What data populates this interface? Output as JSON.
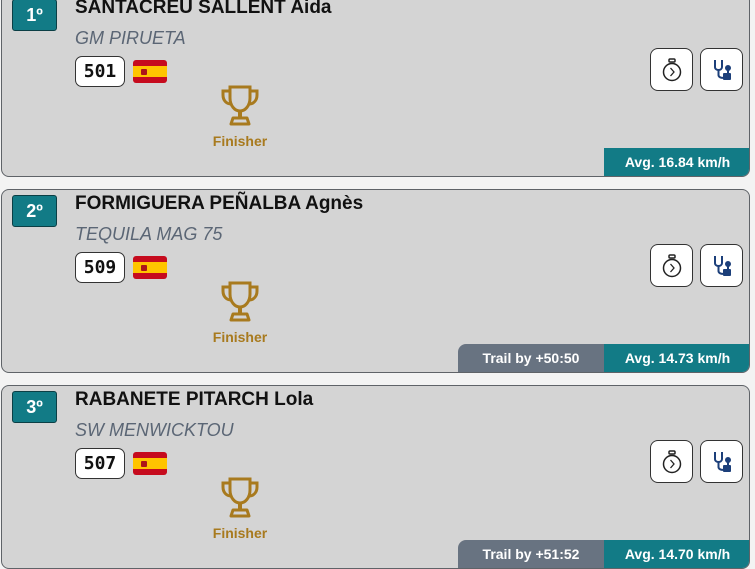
{
  "finisher_label": "Finisher",
  "colors": {
    "accent": "#127b86",
    "trail_bg": "#687381",
    "trophy": "#a87a1e",
    "card_bg": "#d4d4d4"
  },
  "icons": {
    "timer": "stopwatch-icon",
    "medical": "stethoscope-icon",
    "award": "trophy-icon",
    "flag": "spain-flag-icon"
  },
  "riders": [
    {
      "position": "1º",
      "name": "SANTACREU SALLENT Aida",
      "team": "GM PIRUETA",
      "bib": "501",
      "trail": "",
      "avg": "Avg. 16.84 km/h"
    },
    {
      "position": "2º",
      "name": "FORMIGUERA PEÑALBA Agnès",
      "team": "TEQUILA MAG 75",
      "bib": "509",
      "trail": "Trail by +50:50",
      "avg": "Avg. 14.73 km/h"
    },
    {
      "position": "3º",
      "name": "RABANETE PITARCH Lola",
      "team": "SW MENWICKTOU",
      "bib": "507",
      "trail": "Trail by +51:52",
      "avg": "Avg. 14.70 km/h"
    }
  ]
}
